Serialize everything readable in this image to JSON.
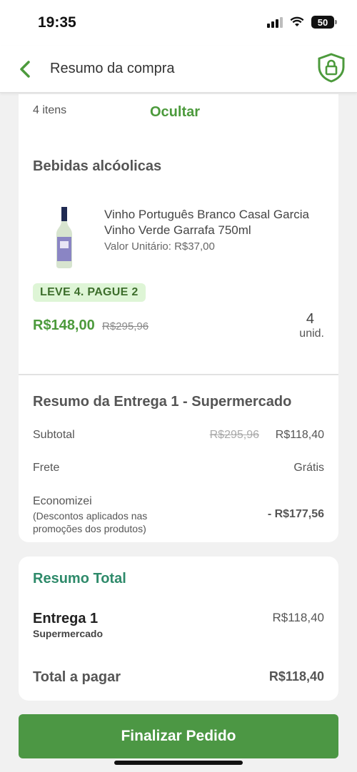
{
  "status_bar": {
    "time": "19:35",
    "battery": "50"
  },
  "header": {
    "title": "Resumo da compra",
    "back_icon": "chevron-left-icon",
    "lock_icon": "shield-lock-icon"
  },
  "items_card": {
    "items_count": "4 itens",
    "hide_label": "Ocultar",
    "category": "Bebidas alcóolicas",
    "product": {
      "name": "Vinho Português Branco Casal Garcia Vinho Verde Garrafa 750ml",
      "unit_price": "Valor Unitário: R$37,00",
      "promo": "LEVE 4. PAGUE 2",
      "price": "R$148,00",
      "old_price": "R$295,96",
      "quantity": "4",
      "quantity_unit": "unid."
    }
  },
  "delivery_summary": {
    "title": "Resumo da Entrega 1 - Supermercado",
    "subtotal_label": "Subtotal",
    "subtotal_old": "R$295,96",
    "subtotal_value": "R$118,40",
    "shipping_label": "Frete",
    "shipping_value": "Grátis",
    "savings_label": "Economizei",
    "savings_note": "(Descontos aplicados nas promoções dos produtos)",
    "savings_value": "- R$177,56"
  },
  "total_card": {
    "title": "Resumo Total",
    "delivery_name": "Entrega 1",
    "delivery_sub": "Supermercado",
    "delivery_value": "R$118,40",
    "pay_label": "Total a pagar",
    "pay_value": "R$118,40"
  },
  "footer": {
    "button_label": "Finalizar Pedido"
  },
  "colors": {
    "accent": "#4c9a3c",
    "button": "#4c9744",
    "promo_bg": "#def5d6",
    "total_title": "#2e8a6a"
  }
}
